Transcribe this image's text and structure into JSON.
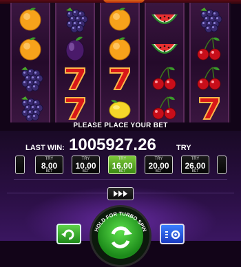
{
  "colors": {
    "accent_green": "#5ce04a",
    "menu_blue": "#2f5cf0",
    "panel_purple": "#2b0f45"
  },
  "reels": [
    [
      "orange",
      "orange",
      "grapes",
      "grapes"
    ],
    [
      "grapes",
      "plum",
      "seven",
      "seven"
    ],
    [
      "orange",
      "orange",
      "seven",
      "lemon"
    ],
    [
      "watermelon",
      "watermelon",
      "cherry",
      "cherry"
    ],
    [
      "grapes",
      "cherry",
      "cherry",
      "seven"
    ]
  ],
  "status": {
    "message": "PLEASE PLACE YOUR BET"
  },
  "last_win": {
    "label": "LAST WIN:",
    "value": "1005927.26",
    "currency": "TRY"
  },
  "bets": [
    {
      "currency": "TRY",
      "amount": "8.00",
      "label": "BET"
    },
    {
      "currency": "TRY",
      "amount": "10.00",
      "label": "BET"
    },
    {
      "currency": "TRY",
      "amount": "16.00",
      "label": "BET",
      "selected": true
    },
    {
      "currency": "TRY",
      "amount": "20.00",
      "label": "BET"
    },
    {
      "currency": "TRY",
      "amount": "26.00",
      "label": "BET"
    }
  ],
  "spin": {
    "hold_text": "HOLD FOR TURBO SPIN"
  },
  "controls": {
    "auto_icon": "play-triple-icon",
    "left_icon": "refresh-icon",
    "right_icon": "settings-menu-icon"
  }
}
